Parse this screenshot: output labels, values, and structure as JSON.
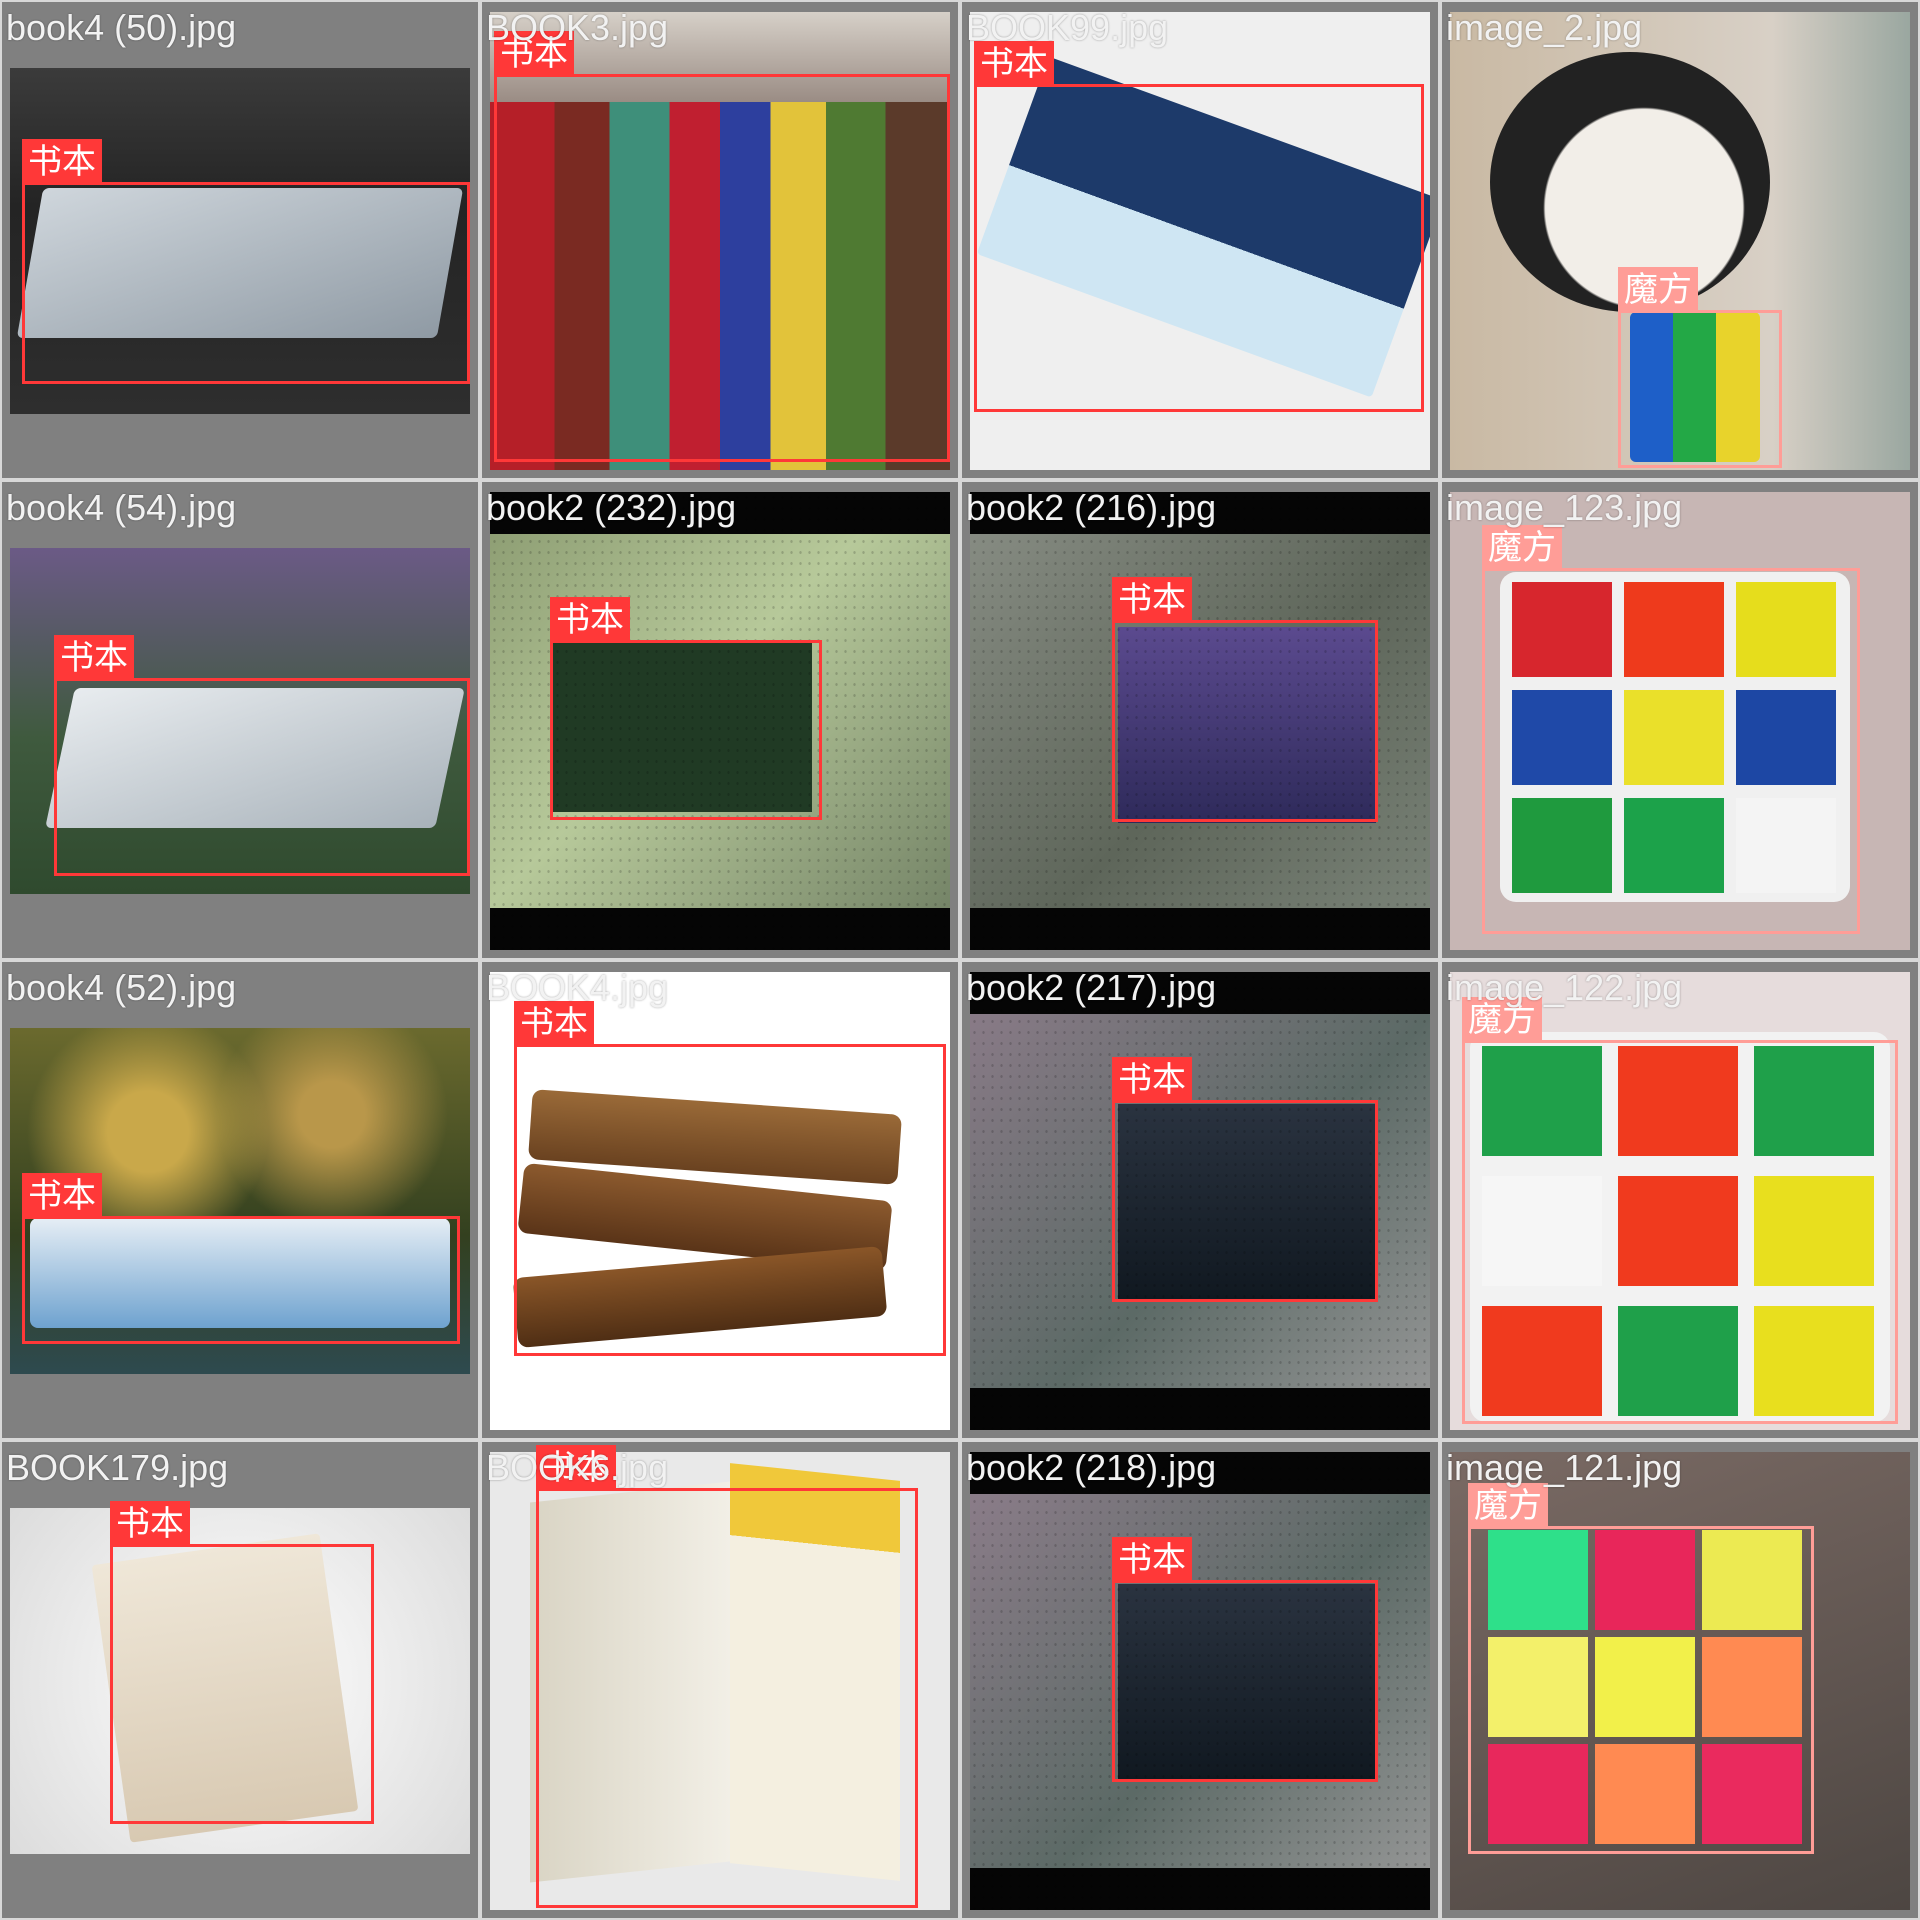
{
  "title": "",
  "colors": {
    "book_box": "#ff3838",
    "cube_box": "#ff9d97",
    "label_text": "#ffffff",
    "filename_text": "#f2f2f2"
  },
  "tiles": [
    {
      "filename": "book4 (50).jpg",
      "label": "书本"
    },
    {
      "filename": "BOOK3.jpg",
      "label": "书本"
    },
    {
      "filename": "BOOK99.jpg",
      "label": "书本"
    },
    {
      "filename": "image_2.jpg",
      "label": "魔方"
    },
    {
      "filename": "book4 (54).jpg",
      "label": "书本"
    },
    {
      "filename": "book2 (232).jpg",
      "label": "书本"
    },
    {
      "filename": "book2 (216).jpg",
      "label": "书本"
    },
    {
      "filename": "image_123.jpg",
      "label": "魔方"
    },
    {
      "filename": "book4 (52).jpg",
      "label": "书本"
    },
    {
      "filename": "BOOK4.jpg",
      "label": "书本"
    },
    {
      "filename": "book2 (217).jpg",
      "label": "书本"
    },
    {
      "filename": "image_122.jpg",
      "label": "魔方"
    },
    {
      "filename": "BOOK179.jpg",
      "label": "书本"
    },
    {
      "filename": "BOOK6.jpg",
      "label": "书本"
    },
    {
      "filename": "book2 (218).jpg",
      "label": "书本"
    },
    {
      "filename": "image_121.jpg",
      "label": "魔方"
    }
  ]
}
